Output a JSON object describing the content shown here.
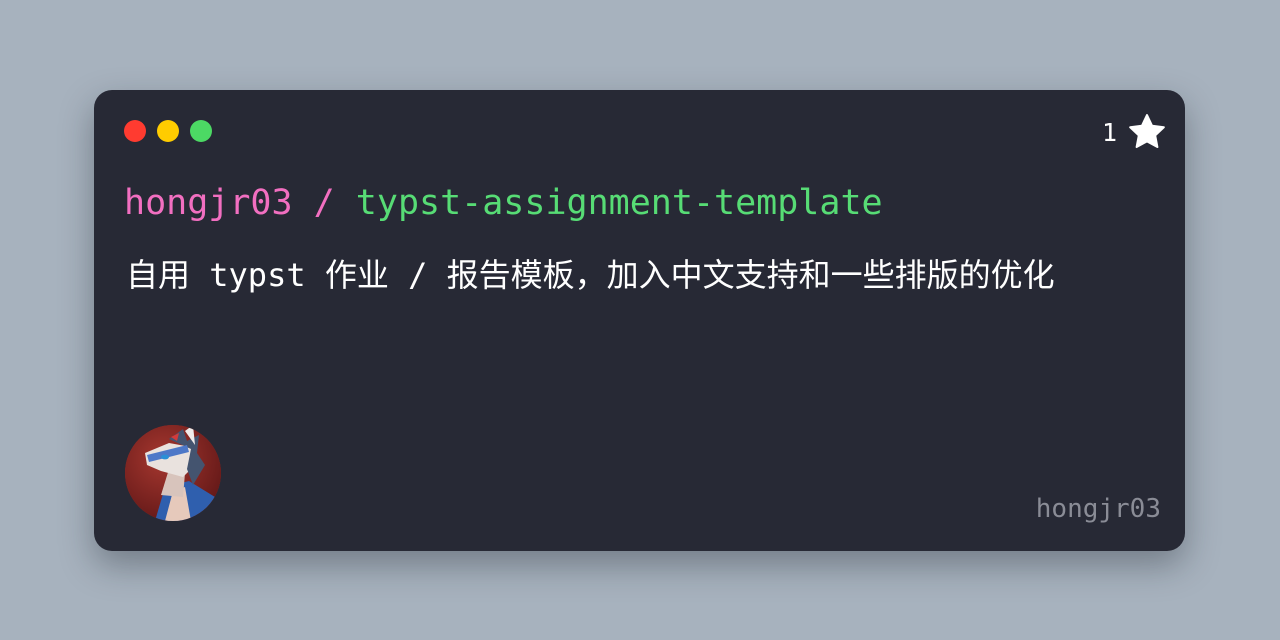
{
  "window": {
    "controls": [
      {
        "name": "close",
        "color": "#ff3b30"
      },
      {
        "name": "minimize",
        "color": "#ffcc00"
      },
      {
        "name": "maximize",
        "color": "#4cd964"
      }
    ]
  },
  "stars": {
    "count": "1",
    "icon": "star-icon"
  },
  "repo": {
    "owner": "hongjr03",
    "separator": " / ",
    "name": "typst-assignment-template",
    "owner_color": "#f26fc1",
    "name_color": "#57dc75"
  },
  "description": "自用 typst 作业 / 报告模板，加入中文支持和一些排版的优化",
  "footer": {
    "username": "hongjr03",
    "avatar_icon": "avatar-icon"
  }
}
